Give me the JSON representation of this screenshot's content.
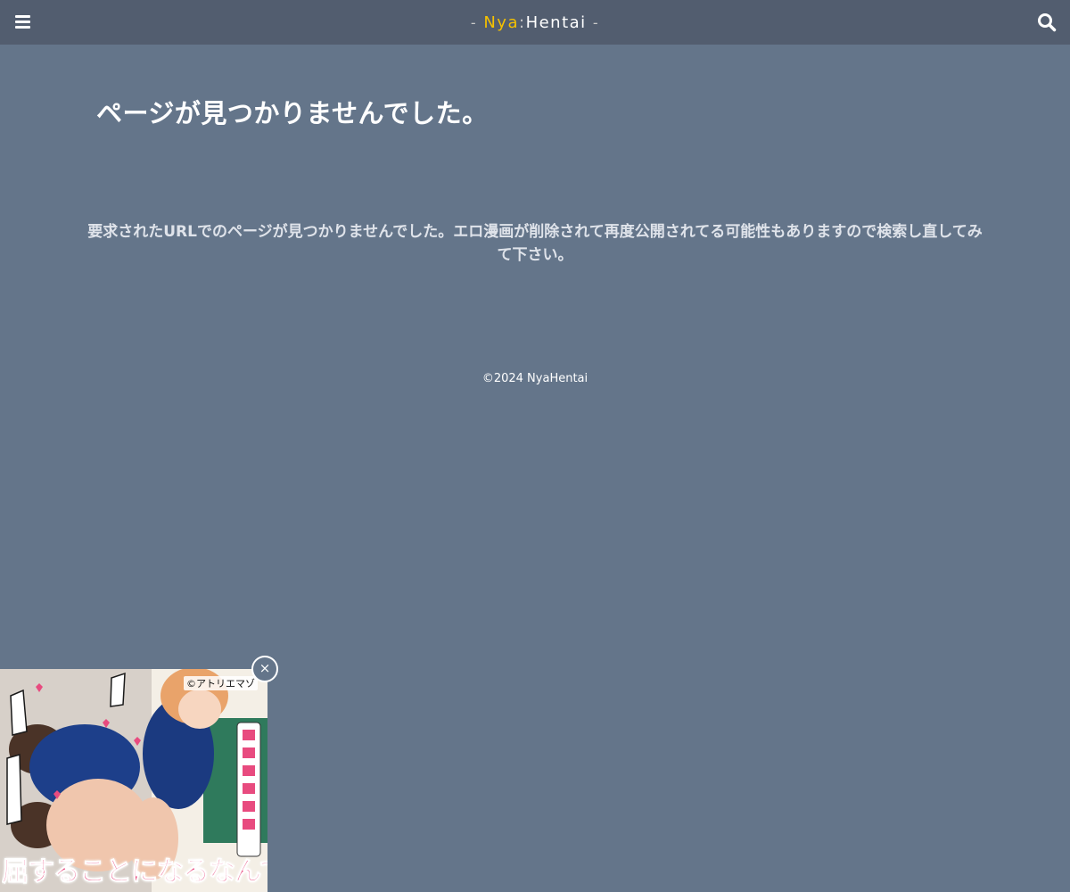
{
  "header": {
    "menu_icon": "hamburger-menu-icon",
    "logo": {
      "dash_left": "-",
      "nya": "Nya",
      "colon": ":",
      "hentai": "Hentai",
      "dash_right": "-"
    },
    "search_icon": "search-icon"
  },
  "main": {
    "title": "ページが見つかりませんでした。",
    "message": "要求されたURLでのページが見つかりませんでした。エロ漫画が削除されて再度公開されてる可能性もありますので検索し直してみて下さい。"
  },
  "footer": {
    "copyright": "©2024 NyaHentai"
  },
  "ad": {
    "credit": "©アトリエマゾ",
    "caption": "屈することになるなんて",
    "close_label": "×"
  },
  "colors": {
    "background": "#64758a",
    "header": "#525d6f",
    "logo_accent": "#f5c100",
    "ad_caption": "#e84b7f"
  }
}
